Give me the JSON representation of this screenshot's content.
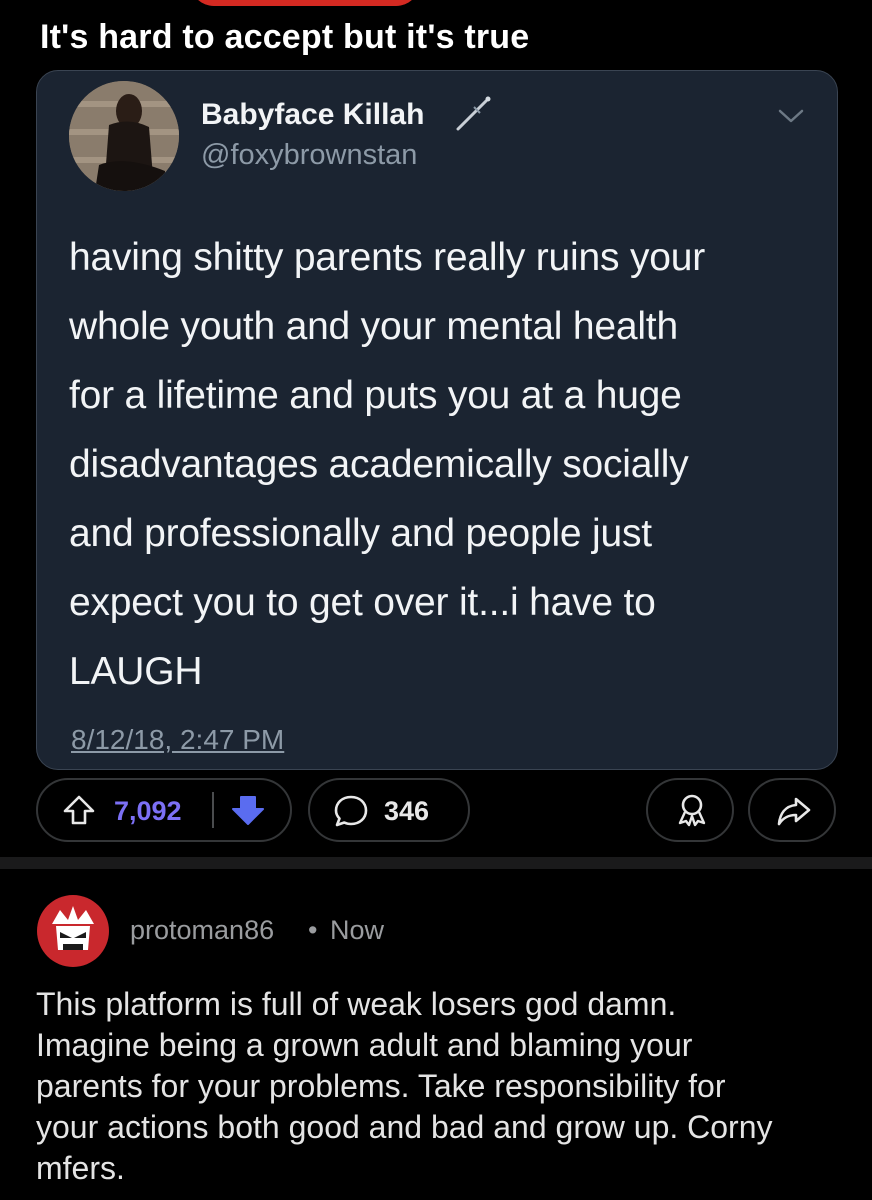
{
  "post": {
    "title": "It's hard to accept but it's true"
  },
  "tweet": {
    "display_name": "Babyface Killah",
    "handle": "@foxybrownstan",
    "name_emoji_icon": "dagger-icon",
    "text_lines": [
      "having shitty parents really ruins your",
      "whole youth and your mental health",
      "for a lifetime and puts you at a huge",
      "disadvantages academically socially",
      "and professionally and people just",
      "expect you to get over it...i have to",
      "LAUGH"
    ],
    "date": "8/12/18, 2:47 PM"
  },
  "actions": {
    "upvote_count": "7,092",
    "comment_count": "346",
    "upvote_color": "#7c70f5",
    "downvote_color": "#5a6cf0"
  },
  "comment": {
    "author": "protoman86",
    "separator": "•",
    "time": "Now",
    "body_lines": [
      "This platform is full of weak losers god damn.",
      "Imagine being a grown adult and blaming your",
      "parents for your problems. Take responsibility for",
      "your actions both good and bad and grow up. Corny",
      "mfers."
    ]
  },
  "colors": {
    "background": "#000000",
    "card": "#1b2431",
    "accent_red": "#d42a22"
  }
}
